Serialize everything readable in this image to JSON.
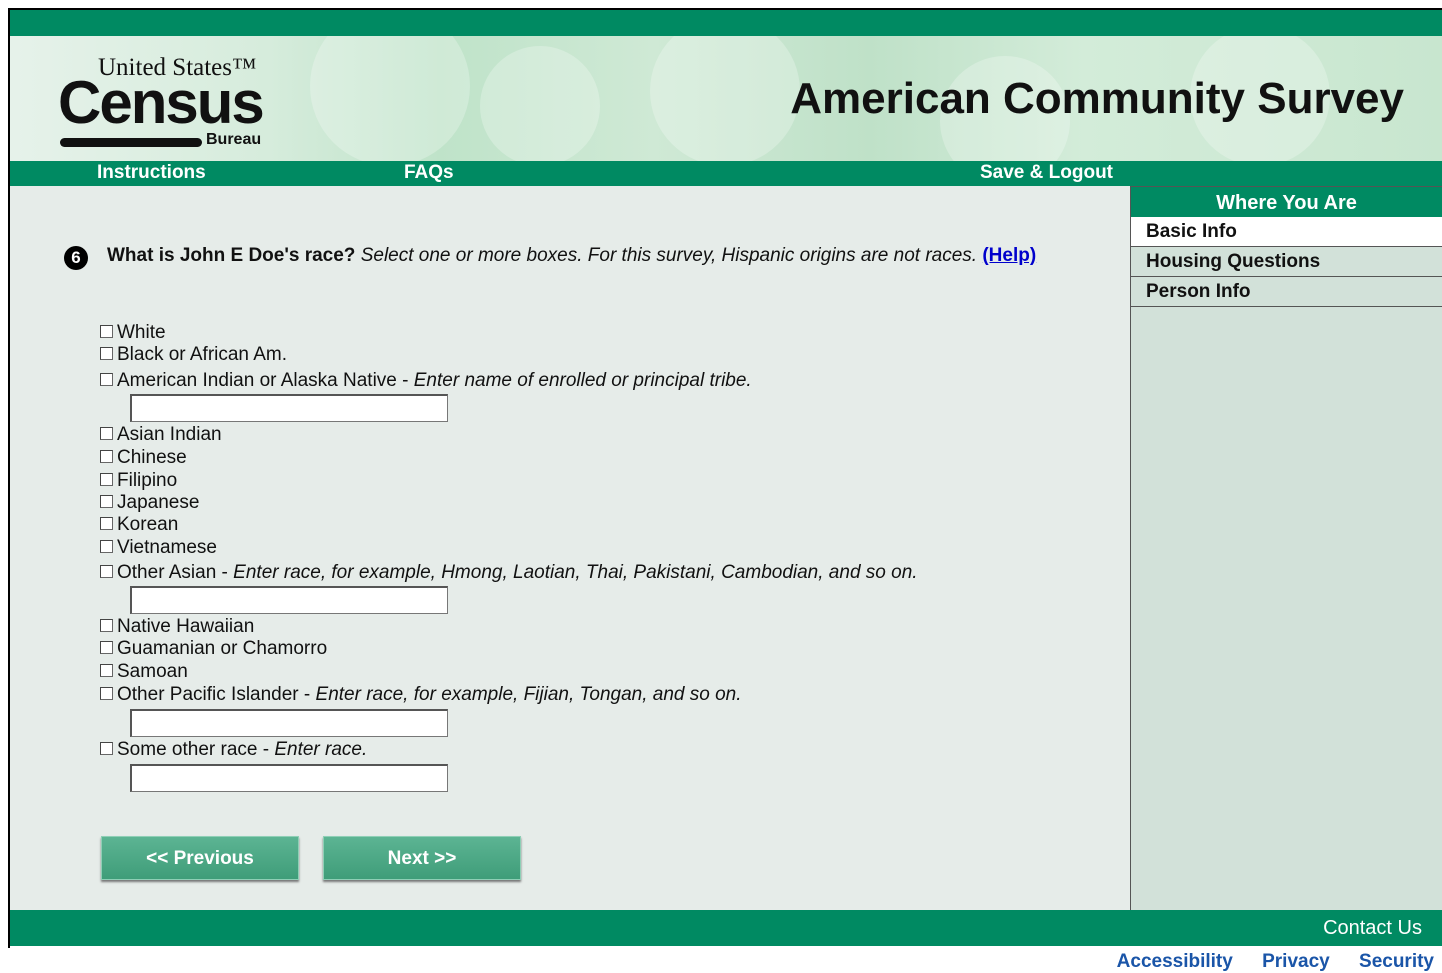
{
  "banner": {
    "logo_united_states": "United States™",
    "logo_census": "Census",
    "logo_bureau": "Bureau",
    "title": "American Community Survey"
  },
  "nav": {
    "instructions": "Instructions",
    "faqs": "FAQs",
    "save_logout": "Save & Logout"
  },
  "sidebar": {
    "heading": "Where You Are",
    "items": [
      {
        "label": "Basic Info",
        "active": true
      },
      {
        "label": "Housing Questions",
        "active": false
      },
      {
        "label": "Person Info",
        "active": false
      }
    ]
  },
  "question": {
    "number": "6",
    "text_bold": "What is John E Doe's race?",
    "text_italic": "Select one or more boxes. For this survey, Hispanic origins are not races.",
    "help_link": "(Help)"
  },
  "options": [
    {
      "label": "White",
      "hint": ""
    },
    {
      "label": "Black or African Am.",
      "hint": ""
    },
    {
      "label": "American Indian or Alaska Native - ",
      "hint": "Enter name of enrolled or principal tribe."
    },
    {
      "label": "Asian Indian",
      "hint": ""
    },
    {
      "label": "Chinese",
      "hint": ""
    },
    {
      "label": "Filipino",
      "hint": ""
    },
    {
      "label": "Japanese",
      "hint": ""
    },
    {
      "label": "Korean",
      "hint": ""
    },
    {
      "label": "Vietnamese",
      "hint": ""
    },
    {
      "label": "Other Asian - ",
      "hint": "Enter race, for example, Hmong, Laotian, Thai, Pakistani, Cambodian, and so on."
    },
    {
      "label": "Native Hawaiian",
      "hint": ""
    },
    {
      "label": "Guamanian or Chamorro",
      "hint": ""
    },
    {
      "label": "Samoan",
      "hint": ""
    },
    {
      "label": "Other Pacific Islander - ",
      "hint": "Enter race, for example, Fijian, Tongan, and so on."
    },
    {
      "label": "Some other race - ",
      "hint": "Enter race."
    }
  ],
  "inputs": {
    "tribe": "",
    "other_asian": "",
    "other_pacific": "",
    "some_other": ""
  },
  "buttons": {
    "previous": "<<  Previous",
    "next": "Next  >>"
  },
  "footer": {
    "contact": "Contact Us",
    "accessibility": "Accessibility",
    "privacy": "Privacy",
    "security": "Security"
  }
}
